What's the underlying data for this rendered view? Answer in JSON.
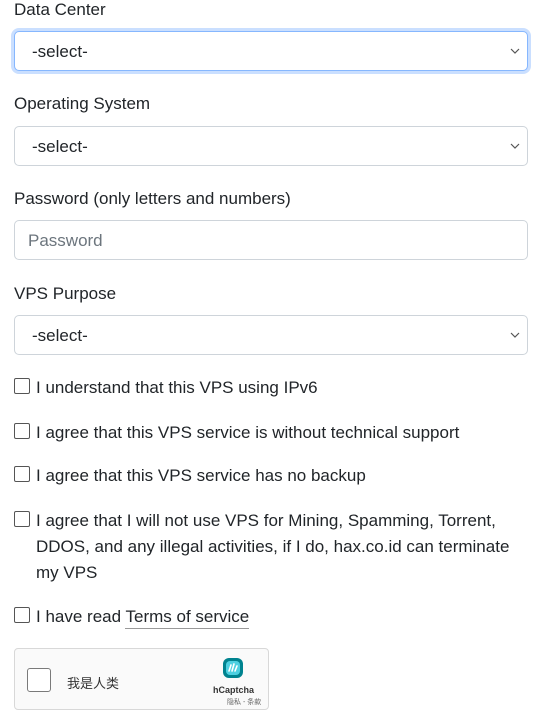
{
  "data_center": {
    "label": "Data Center",
    "value": "-select-"
  },
  "operating_system": {
    "label": "Operating System",
    "value": "-select-"
  },
  "password": {
    "label": "Password (only letters and numbers)",
    "placeholder": "Password"
  },
  "vps_purpose": {
    "label": "VPS Purpose",
    "value": "-select-"
  },
  "agreements": [
    {
      "text": "I understand that this VPS using IPv6",
      "checked": false
    },
    {
      "text": "I agree that this VPS service is without technical support",
      "checked": false
    },
    {
      "text": "I agree that this VPS service has no backup",
      "checked": false
    },
    {
      "text": "I agree that I will not use VPS for Mining, Spamming, Torrent, DDOS, and any illegal activities, if I do, hax.co.id can terminate my VPS",
      "checked": false
    }
  ],
  "tos": {
    "prefix": "I have read",
    "link": "Terms of service",
    "checked": false
  },
  "captcha": {
    "label": "我是人类",
    "brand": "hCaptcha",
    "links": "隐私 - 条款",
    "icon": "hcaptcha-logo-icon"
  },
  "colors": {
    "focus_border": "#86b7fe",
    "input_border": "#ced4da",
    "text": "#212529",
    "placeholder": "#6c757d"
  }
}
